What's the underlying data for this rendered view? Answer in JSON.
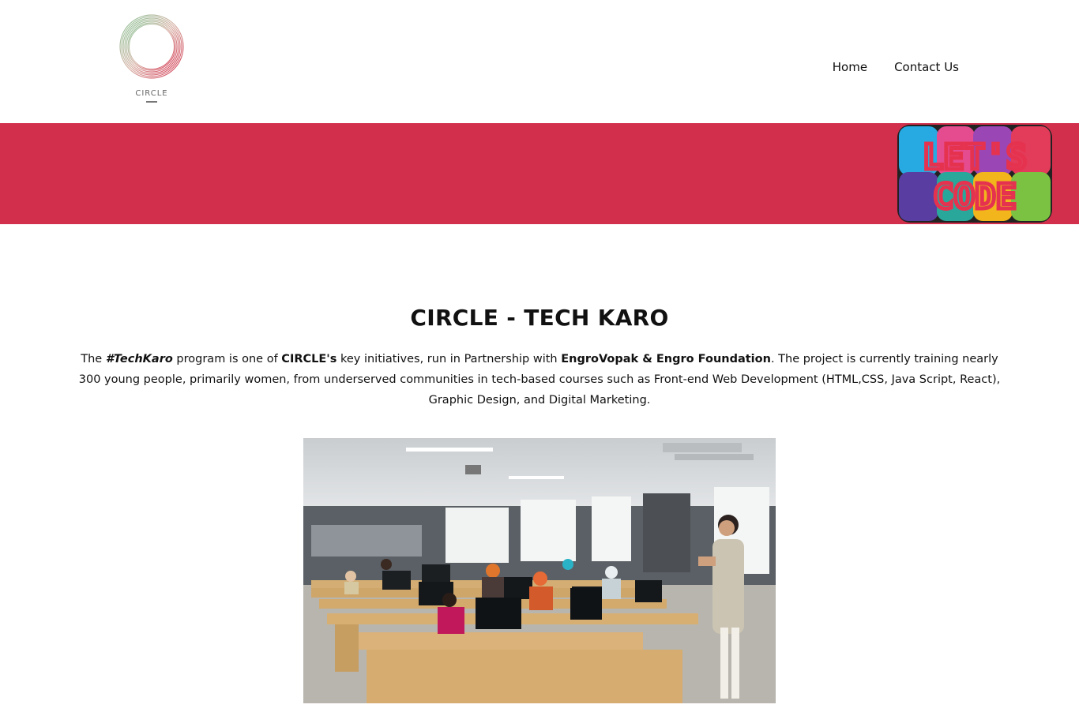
{
  "site": {
    "logo_text": "CIRCLE",
    "logo_icon": "circle-logo-icon"
  },
  "nav": {
    "items": [
      {
        "label": "Home"
      },
      {
        "label": "Contact Us"
      }
    ]
  },
  "banner": {
    "color": "#d12f4c",
    "badge": {
      "line1": "LET'S",
      "line2": "CODE",
      "icon": "lets-code-badge"
    }
  },
  "main": {
    "title": "CIRCLE - TECH KARO",
    "intro": {
      "p1": "The ",
      "techkaro": "#TechKaro",
      "p2": " program is one of ",
      "circles": "CIRCLE's",
      "p3": " key initiatives, run in Partnership with ",
      "partners": "EngroVopak & Engro Foundation",
      "p4": ". The project is currently training nearly 300 young people, primarily women, from underserved communities in tech-based courses such as Front-end Web Development (HTML,CSS, Java Script, React), Graphic Design, and Digital Marketing."
    },
    "photo": {
      "icon": "classroom-photo"
    }
  }
}
